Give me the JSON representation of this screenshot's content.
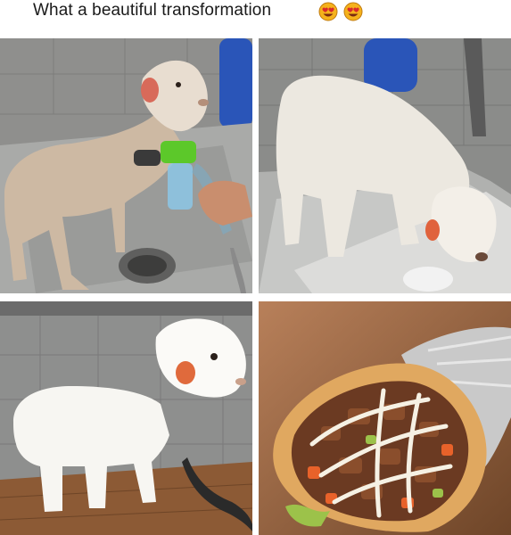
{
  "caption": {
    "text": "What a beautiful transformation",
    "emoji": [
      "heart-eyes-emoji",
      "heart-eyes-emoji"
    ]
  },
  "panels": [
    {
      "subject": "wet lamb being sprayed with hose in sink"
    },
    {
      "subject": "washed fluffy lamb leaning over sink edge"
    },
    {
      "subject": "groomed white lamb standing on wooden floor"
    },
    {
      "subject": "shawarma wrap with sauce and vegetables"
    }
  ]
}
